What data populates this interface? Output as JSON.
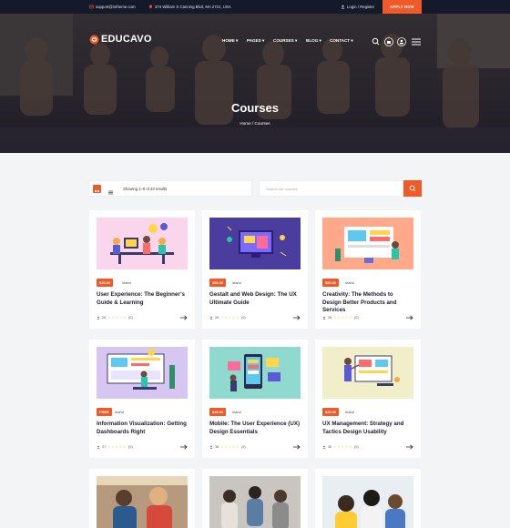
{
  "topbar": {
    "email": "support@rstheme.com",
    "address": "374 William S Canning Blvd, MA 2721, USA",
    "login": "Login / Register",
    "apply": "APPLY NOW"
  },
  "brand": {
    "name": "EDUCAVO",
    "accent": "#f05a28"
  },
  "nav": {
    "items": [
      "HOME",
      "PAGES",
      "COURSES",
      "BLOG",
      "CONTACT"
    ],
    "active": "COURSES",
    "icons": [
      "search-icon",
      "cart-icon",
      "user-icon",
      "menu-icon"
    ]
  },
  "hero": {
    "title": "Courses",
    "crumb_home": "Home",
    "crumb_sep": "/",
    "crumb_current": "Courses"
  },
  "toolbar": {
    "showing": "Showing 1–9 of 43 results",
    "search_placeholder": "Search our courses"
  },
  "courses": [
    {
      "price": "$40.00",
      "unit": "/ea/ui",
      "title": "User Experience: The Beginner’s Guide & Learning",
      "students": "26",
      "rating": "(0)"
    },
    {
      "price": "$50.00",
      "unit": "/ea/ui",
      "title": "Gestalt and Web Design: The UX Ultimate Guide",
      "students": "29",
      "rating": "(0)"
    },
    {
      "price": "$50.00",
      "unit": "/ea/ui",
      "title": "Creativity: The Methods to Design Better Products and Services",
      "students": "26",
      "rating": "(0)"
    },
    {
      "price": "FREE",
      "unit": "/ea/ui",
      "title": "Information Visualization: Getting Dashboards Right",
      "students": "27",
      "rating": "(0)"
    },
    {
      "price": "$40.00",
      "unit": "/ea/ui",
      "title": "Mobile: The User Experience (UX) Design Essentials",
      "students": "36",
      "rating": "(0)"
    },
    {
      "price": "$40.00",
      "unit": "/ea/ui",
      "title": "UX Management: Strategy and Tactics Design Usability",
      "students": "30",
      "rating": "(0)"
    }
  ],
  "stars": "☆☆☆☆☆"
}
